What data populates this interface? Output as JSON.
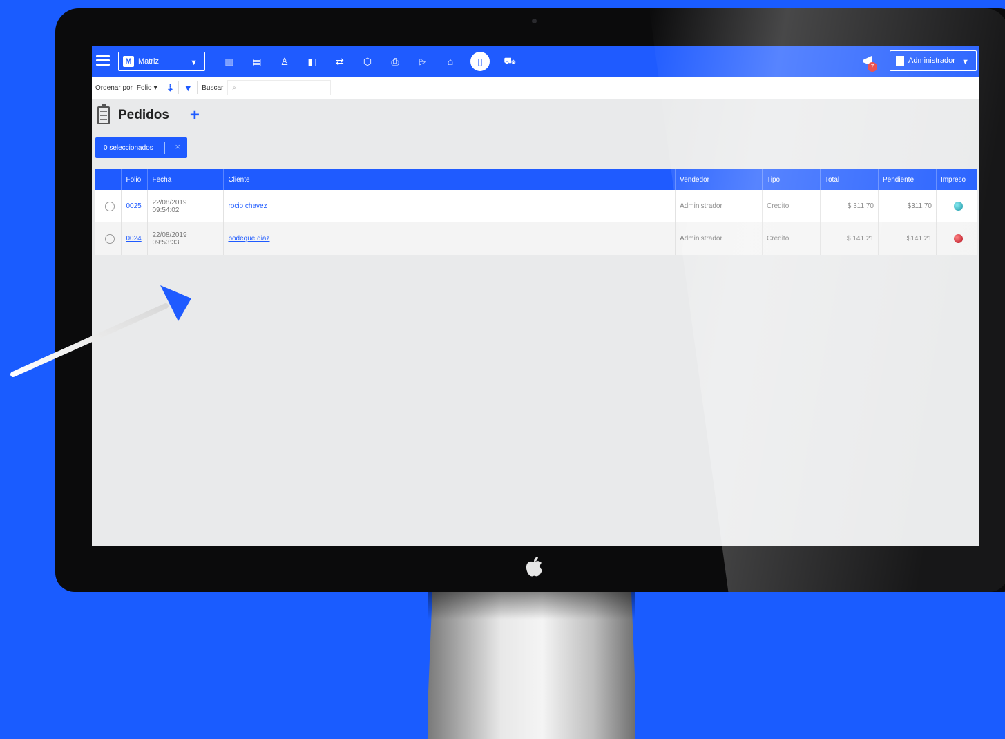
{
  "app": {
    "branch": "Matriz",
    "branch_logo": "M",
    "user": "Administrador",
    "notifications": "7",
    "nav_icons": [
      "chart-icon",
      "keyboard-icon",
      "person-icon",
      "cash-icon",
      "transfer-icon",
      "box-icon",
      "printer-icon",
      "tag-icon",
      "basket-icon",
      "clipboard-icon",
      "cart-icon"
    ]
  },
  "toolbar": {
    "sort_label": "Ordenar por",
    "sort_value": "Folio",
    "search_label": "Buscar"
  },
  "page": {
    "title": "Pedidos",
    "add": "+",
    "selected_label": "0 seleccionados",
    "clear": "×"
  },
  "table": {
    "headers": [
      "",
      "Folio",
      "Fecha",
      "Cliente",
      "Vendedor",
      "Tipo",
      "Total",
      "Pendiente",
      "Impreso"
    ],
    "rows": [
      {
        "folio": "0025",
        "date": "22/08/2019",
        "time": "09:54:02",
        "cliente": "rocio chavez",
        "vendedor": "Administrador",
        "tipo": "Credito",
        "total": "$ 311.70",
        "pendiente": "$311.70",
        "impreso": "teal"
      },
      {
        "folio": "0024",
        "date": "22/08/2019",
        "time": "09:53:33",
        "cliente": "bodeque diaz",
        "vendedor": "Administrador",
        "tipo": "Credito",
        "total": "$ 141.21",
        "pendiente": "$141.21",
        "impreso": "red"
      }
    ]
  },
  "colors": {
    "accent": "#1f5bff",
    "background": "#1a5cff"
  }
}
